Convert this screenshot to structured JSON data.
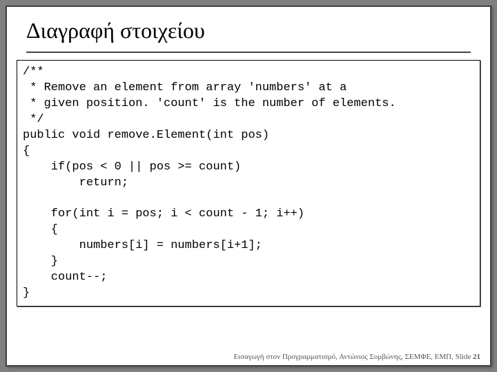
{
  "slide": {
    "title": "Διαγραφή στοιχείου",
    "code_lines": [
      "/**",
      " * Remove an element from array 'numbers' at a",
      " * given position. 'count' is the number of elements.",
      " */",
      "public void remove.Element(int pos)",
      "{",
      "    if(pos < 0 || pos >= count)",
      "        return;",
      "",
      "    for(int i = pos; i < count - 1; i++)",
      "    {",
      "        numbers[i] = numbers[i+1];",
      "    }",
      "    count--;",
      "}"
    ],
    "footer": {
      "text": "Εισαγωγή στον Προγραμματισμό, Αντώνιος Συμβώνης, ΣΕΜΦΕ, ΕΜΠ, ",
      "slide_label": "Slide ",
      "slide_number": "21"
    }
  }
}
